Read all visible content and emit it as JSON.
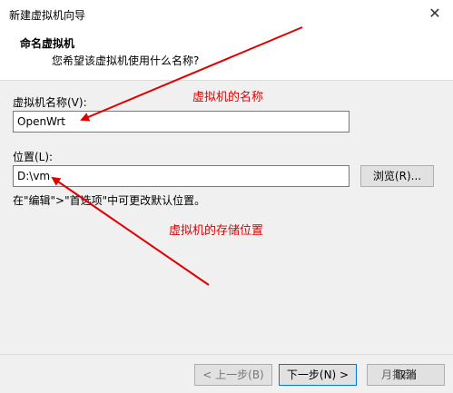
{
  "window": {
    "title": "新建虚拟机向导",
    "close_glyph": "✕"
  },
  "header": {
    "title": "命名虚拟机",
    "subtitle": "您希望该虚拟机使用什么名称?"
  },
  "form": {
    "name_label": "虚拟机名称(V):",
    "name_value": "OpenWrt",
    "location_label": "位置(L):",
    "location_value": "D:\\vm",
    "browse_label": "浏览(R)...",
    "hint": "在\"编辑\">\"首选项\"中可更改默认位置。"
  },
  "buttons": {
    "back": "< 上一步(B)",
    "next": "下一步(N) >",
    "cancel": "取消"
  },
  "annotations": {
    "name_note": "虚拟机的名称",
    "location_note": "虚拟机的存储位置",
    "color": "#e00000"
  },
  "watermark": "月指南"
}
